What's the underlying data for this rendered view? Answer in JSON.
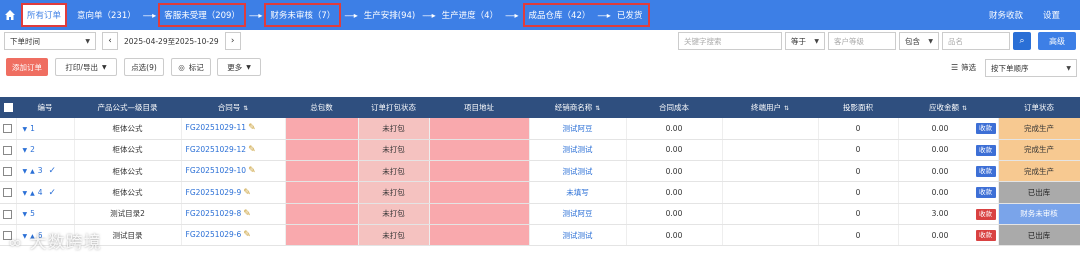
{
  "nav": {
    "tabs": [
      {
        "label": "所有订单"
      },
      {
        "label": "意向单（231）"
      },
      {
        "label": "客服未受理（209）"
      },
      {
        "label": "财务未审核（7）"
      },
      {
        "label": "生产安排(94)"
      },
      {
        "label": "生产进度（4）"
      },
      {
        "label": "成品仓库（42）"
      },
      {
        "label": "已发货"
      }
    ],
    "arrow": "-----▸",
    "right": {
      "finance": "财务收款",
      "settings": "设置"
    }
  },
  "filters": {
    "time_select": "下单时间",
    "date_range": "2025-04-29至2025-10-29",
    "keyword_placeholder": "关键字搜索",
    "op1": "等于",
    "level_placeholder": "客户等级",
    "op2": "包含",
    "name_placeholder": "品名",
    "search_icon": "search-icon",
    "advanced": "高级"
  },
  "actions": {
    "add_order": "添加订单",
    "print_export": "打印/导出",
    "point_select": "点选(9)",
    "mark": "标记",
    "more": "更多",
    "filter": "筛选",
    "sort_select": "按下单顺序"
  },
  "table": {
    "headers": [
      "编号",
      "产品公式—级目录",
      "合同号",
      "总包数",
      "订单打包状态",
      "项目地址",
      "经销商名称",
      "合同成本",
      "终端用户",
      "投影面积",
      "应收金额",
      "订单状态"
    ],
    "rows": [
      {
        "num": "1",
        "cat": "柜体公式",
        "contract": "FG20251029-11",
        "pack": "未打包",
        "dealer": "测试阿豆",
        "cost": "0.00",
        "area": "0",
        "amount": "0.00",
        "tag": "收款",
        "tag_color": "blue",
        "status": "完成生产",
        "status_color": "orange",
        "up": false,
        "check": false
      },
      {
        "num": "2",
        "cat": "柜体公式",
        "contract": "FG20251029-12",
        "pack": "未打包",
        "dealer": "测试测试",
        "cost": "0.00",
        "area": "0",
        "amount": "0.00",
        "tag": "收款",
        "tag_color": "blue",
        "status": "完成生产",
        "status_color": "orange",
        "up": false,
        "check": false
      },
      {
        "num": "3",
        "cat": "柜体公式",
        "contract": "FG20251029-10",
        "pack": "未打包",
        "dealer": "测试测试",
        "cost": "0.00",
        "area": "0",
        "amount": "0.00",
        "tag": "收款",
        "tag_color": "blue",
        "status": "完成生产",
        "status_color": "orange",
        "up": true,
        "check": true
      },
      {
        "num": "4",
        "cat": "柜体公式",
        "contract": "FG20251029-9",
        "pack": "未打包",
        "dealer": "未填写",
        "cost": "0.00",
        "area": "0",
        "amount": "0.00",
        "tag": "收款",
        "tag_color": "blue",
        "status": "已出库",
        "status_color": "gray",
        "up": true,
        "check": true
      },
      {
        "num": "5",
        "cat": "测试目录2",
        "contract": "FG20251029-8",
        "pack": "未打包",
        "dealer": "测试阿豆",
        "cost": "0.00",
        "area": "0",
        "amount": "3.00",
        "tag": "收款",
        "tag_color": "red",
        "status": "财务未审核",
        "status_color": "blue",
        "up": false,
        "check": false
      },
      {
        "num": "6",
        "cat": "测试目录",
        "contract": "FG20251029-6",
        "pack": "未打包",
        "dealer": "测试测试",
        "cost": "0.00",
        "area": "0",
        "amount": "0.00",
        "tag": "收款",
        "tag_color": "red",
        "status": "已出库",
        "status_color": "gray",
        "up": true,
        "check": false
      }
    ]
  },
  "watermark": "大数跨境"
}
